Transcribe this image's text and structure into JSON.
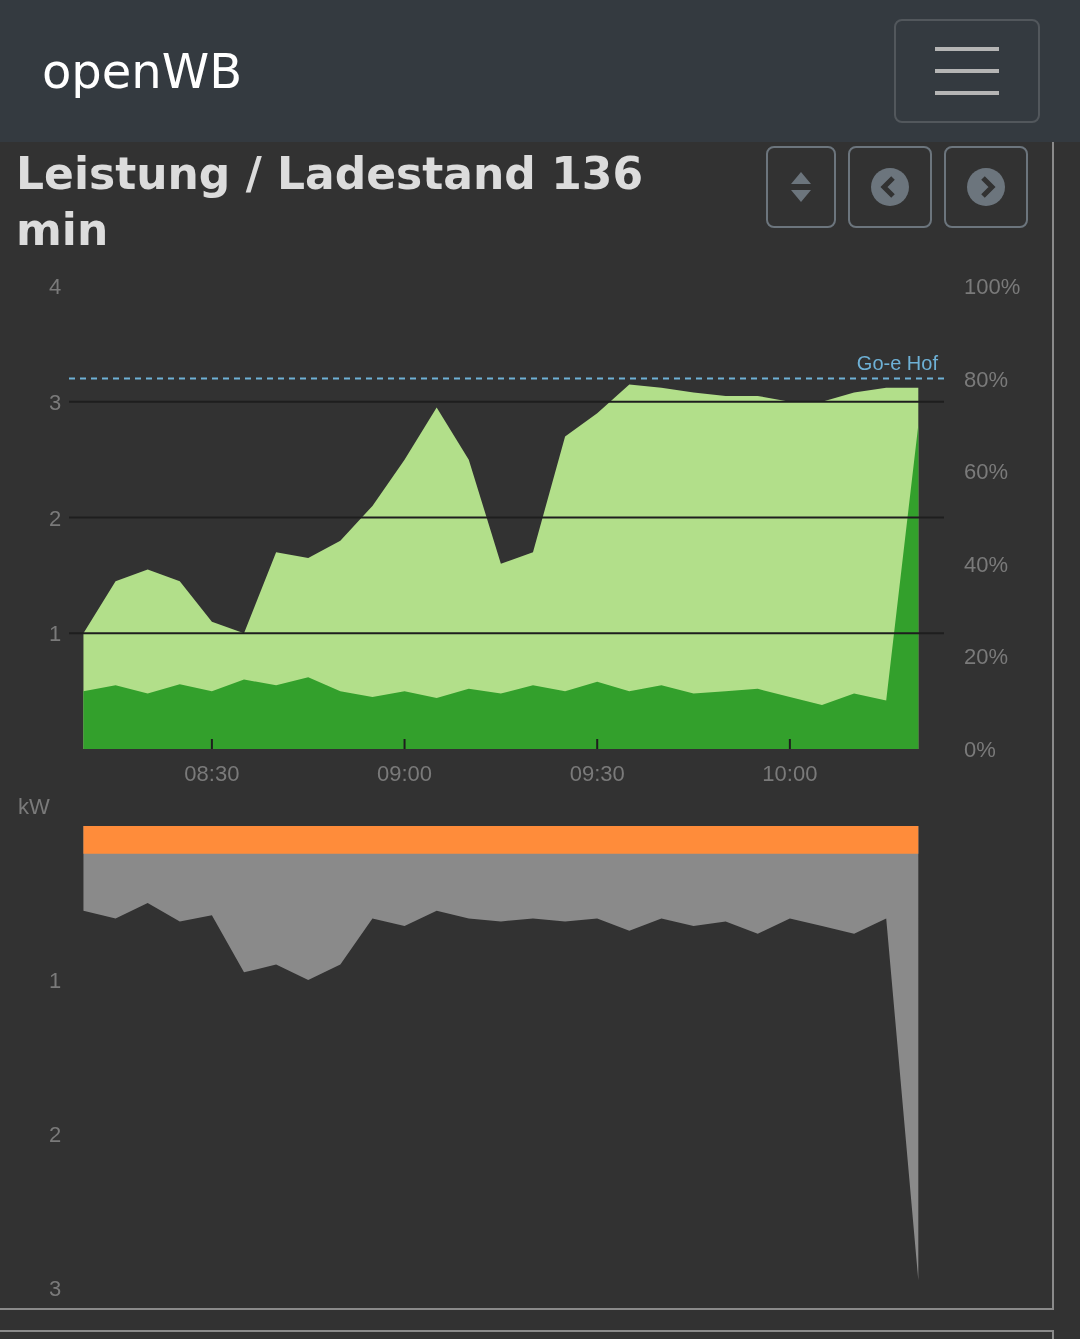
{
  "navbar": {
    "brand": "openWB"
  },
  "card": {
    "title": "Leistung / Ladestand 136 min",
    "buttons": [
      {
        "kind": "sort"
      },
      {
        "kind": "previous"
      },
      {
        "kind": "next"
      }
    ]
  },
  "power_chart": {
    "chart_data": {
      "type": "area",
      "categories": [
        null,
        null,
        null,
        null,
        "08:30",
        null,
        null,
        null,
        null,
        null,
        "09:00",
        null,
        null,
        null,
        null,
        null,
        "09:30",
        null,
        null,
        null,
        null,
        null,
        "10:00",
        null,
        null,
        null,
        null
      ],
      "series": [
        {
          "color": "#b2df8a",
          "values": [
            1.0,
            1.45,
            1.55,
            1.45,
            1.1,
            1.0,
            1.7,
            1.65,
            1.8,
            2.1,
            2.5,
            2.95,
            2.5,
            1.6,
            1.7,
            2.7,
            2.9,
            3.15,
            3.12,
            3.08,
            3.05,
            3.05,
            3.0,
            3.0,
            3.08,
            3.12,
            3.12
          ]
        },
        {
          "color": "#33a02c",
          "values": [
            0.5,
            0.55,
            0.48,
            0.56,
            0.5,
            0.6,
            0.55,
            0.62,
            0.5,
            0.45,
            0.5,
            0.44,
            0.52,
            0.48,
            0.55,
            0.5,
            0.58,
            0.5,
            0.55,
            0.48,
            0.5,
            0.52,
            0.45,
            0.38,
            0.48,
            0.42,
            2.8
          ]
        }
      ],
      "ylim": [
        0,
        4
      ],
      "grid": true,
      "yticks": [
        1,
        2,
        3,
        4
      ],
      "y2lim": [
        0,
        100
      ],
      "y2ticks": [
        {
          "value": 0,
          "label": "0%"
        },
        {
          "value": 20,
          "label": "20%"
        },
        {
          "value": 40,
          "label": "40%"
        },
        {
          "value": 60,
          "label": "60%"
        },
        {
          "value": 80,
          "label": "80%"
        },
        {
          "value": 100,
          "label": "100%"
        }
      ],
      "ref_lines": [
        {
          "axis": "y2",
          "value": 80,
          "label": "Go-e Hof"
        }
      ]
    }
  },
  "grid_chart": {
    "chart_data": {
      "type": "area",
      "ylabel": "kW",
      "categories": [
        null,
        null,
        null,
        null,
        null,
        null,
        null,
        null,
        null,
        null,
        null,
        null,
        null,
        null,
        null,
        null,
        null,
        null,
        null,
        null,
        null,
        null,
        null,
        null,
        null,
        null,
        null
      ],
      "series": [
        {
          "color": "#8a8a8a",
          "values": [
            0.55,
            0.6,
            0.5,
            0.62,
            0.58,
            0.95,
            0.9,
            1.0,
            0.9,
            0.6,
            0.65,
            0.55,
            0.6,
            0.62,
            0.6,
            0.62,
            0.6,
            0.68,
            0.6,
            0.65,
            0.62,
            0.7,
            0.6,
            0.65,
            0.7,
            0.6,
            2.95
          ]
        },
        {
          "color": "#ff8c3a",
          "values": [
            0.18,
            0.18,
            0.18,
            0.18,
            0.18,
            0.18,
            0.18,
            0.18,
            0.18,
            0.18,
            0.18,
            0.18,
            0.18,
            0.18,
            0.18,
            0.18,
            0.18,
            0.18,
            0.18,
            0.18,
            0.18,
            0.18,
            0.18,
            0.18,
            0.18,
            0.18,
            0.18
          ]
        }
      ],
      "ylim": [
        3,
        0
      ],
      "yticks": [
        1,
        2,
        3
      ]
    }
  }
}
